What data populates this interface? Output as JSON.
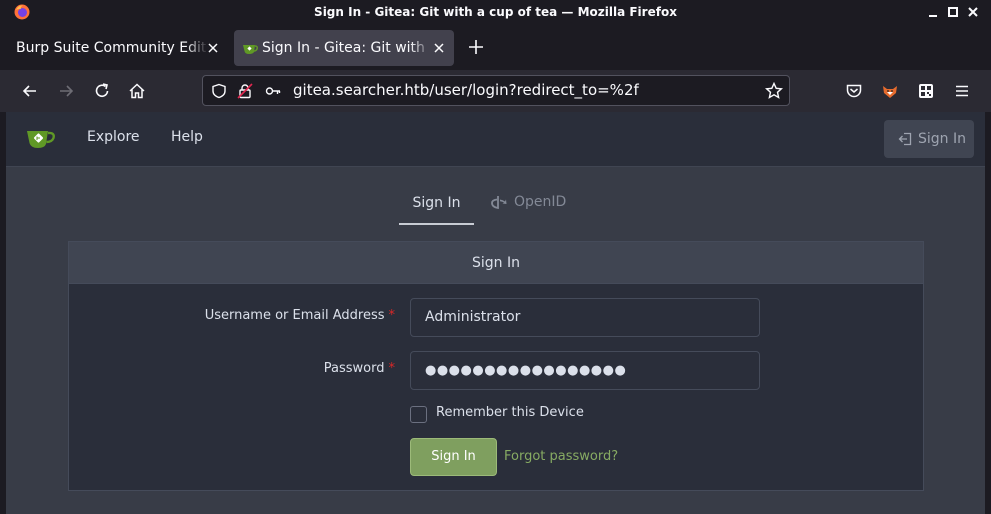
{
  "window": {
    "title": "Sign In - Gitea: Git with a cup of tea — Mozilla Firefox"
  },
  "tabs": [
    {
      "label": "Burp Suite Community Edition",
      "active": false
    },
    {
      "label": "Sign In - Gitea: Git with a cup of tea",
      "active": true
    }
  ],
  "urlbar": {
    "url": "gitea.searcher.htb/user/login?redirect_to=%2f"
  },
  "gitea": {
    "nav": {
      "explore": "Explore",
      "help": "Help",
      "sign_in": "Sign In"
    },
    "auth_tabs": {
      "sign_in": "Sign In",
      "openid": "OpenID"
    },
    "form": {
      "header": "Sign In",
      "username_label": "Username or Email Address",
      "username_value": "Administrator",
      "password_label": "Password",
      "password_value": "●●●●●●●●●●●●●●●●●",
      "required_mark": "*",
      "remember_label": "Remember this Device",
      "remember_checked": false,
      "submit_label": "Sign In",
      "forgot_label": "Forgot password?"
    }
  },
  "colors": {
    "accent_green": "#7f9f5f",
    "link_green": "#87ab63",
    "required_red": "#db2828"
  }
}
